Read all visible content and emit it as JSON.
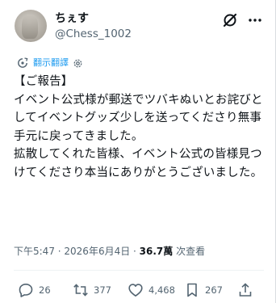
{
  "author": {
    "display_name": "ちぇす",
    "handle": "@Chess_1002"
  },
  "translate": {
    "label": "翻示翻譯"
  },
  "post": {
    "text": "【ご報告】\nイベント公式様が郵送でツバキぬいとお詫びとしてイベントグッズ少しを送ってくださり無事手元に戻ってきました。\n拡散してくれた皆様、イベント公式の皆様見つけてくださり本当にありがとうございました。"
  },
  "meta": {
    "time": "下午5:47",
    "sep1": " · ",
    "date": "2026年6月4日",
    "sep2": " · ",
    "views_count": "36.7萬",
    "views_label": " 次查看"
  },
  "actions": {
    "replies": "26",
    "reposts": "377",
    "likes": "4,468",
    "bookmarks": "267"
  },
  "icons": {
    "grok": "grok-icon",
    "more": "more-icon",
    "translate": "translate-icon",
    "settings": "settings-icon",
    "reply": "reply-icon",
    "repost": "repost-icon",
    "like": "heart-icon",
    "bookmark": "bookmark-icon",
    "share": "share-icon"
  },
  "colors": {
    "text": "#0f1419",
    "secondary": "#536471",
    "accent": "#1d9bf0"
  }
}
